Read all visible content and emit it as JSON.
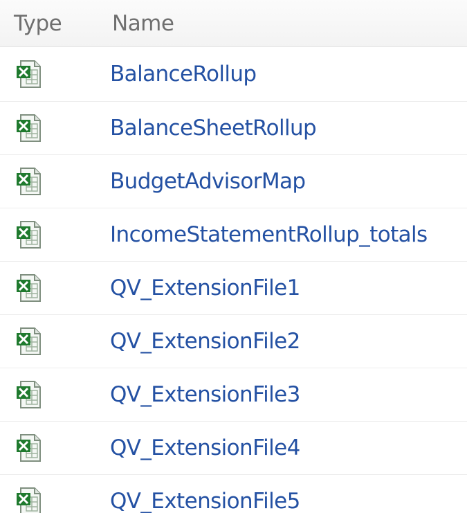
{
  "header": {
    "type_label": "Type",
    "name_label": "Name"
  },
  "rows": [
    {
      "icon": "excel-file-icon",
      "name": "BalanceRollup"
    },
    {
      "icon": "excel-file-icon",
      "name": "BalanceSheetRollup"
    },
    {
      "icon": "excel-file-icon",
      "name": "BudgetAdvisorMap"
    },
    {
      "icon": "excel-file-icon",
      "name": "IncomeStatementRollup_totals"
    },
    {
      "icon": "excel-file-icon",
      "name": "QV_ExtensionFile1"
    },
    {
      "icon": "excel-file-icon",
      "name": "QV_ExtensionFile2"
    },
    {
      "icon": "excel-file-icon",
      "name": "QV_ExtensionFile3"
    },
    {
      "icon": "excel-file-icon",
      "name": "QV_ExtensionFile4"
    },
    {
      "icon": "excel-file-icon",
      "name": "QV_ExtensionFile5"
    }
  ],
  "colors": {
    "link": "#2451a3",
    "header_text": "#6f6f6f",
    "excel_green": "#1f7a2e"
  }
}
